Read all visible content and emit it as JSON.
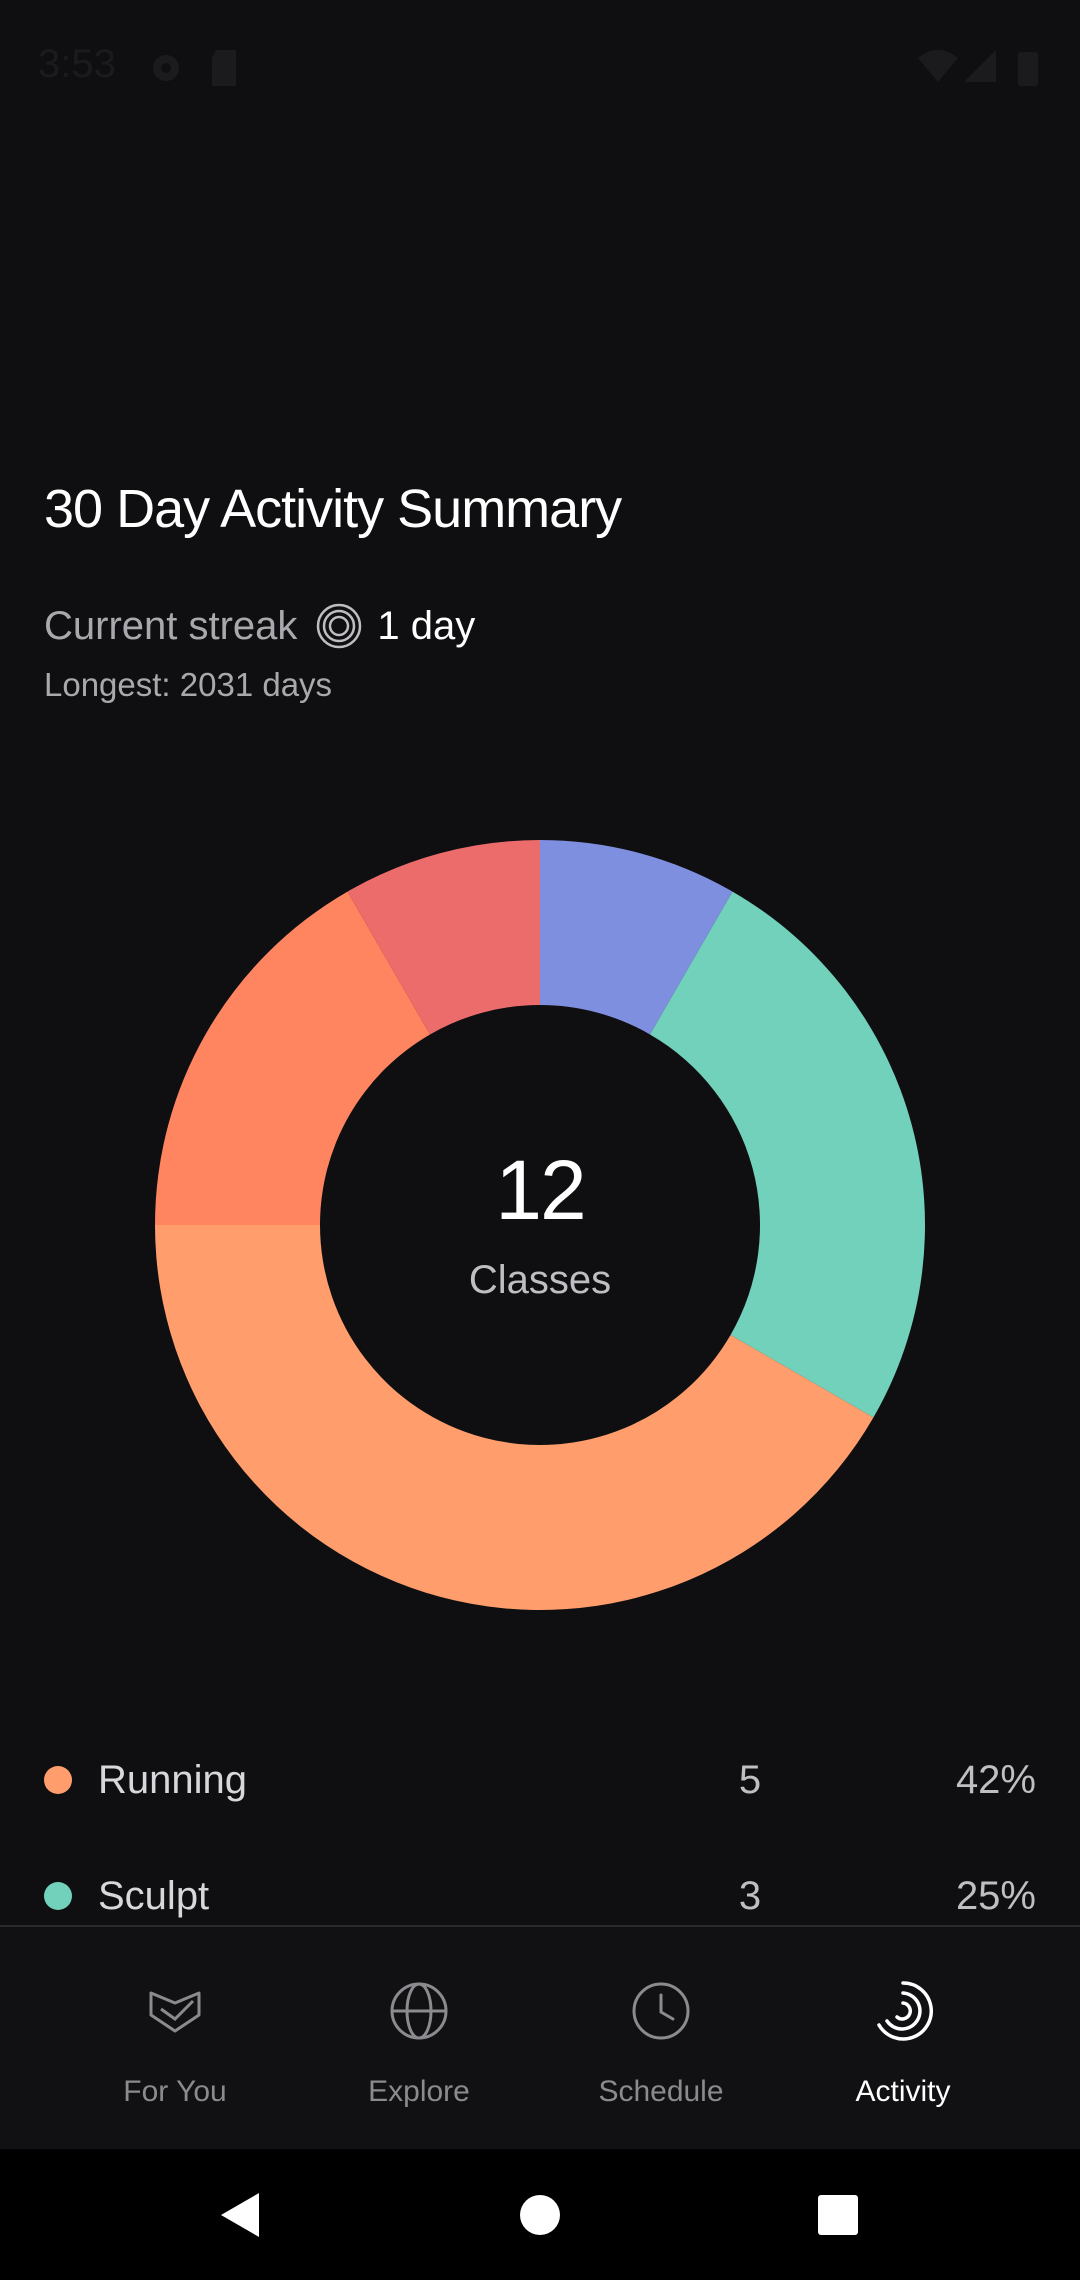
{
  "status_bar": {
    "time": "3:53"
  },
  "header": {
    "title": "30 Day Activity Summary",
    "streak_label": "Current streak",
    "streak_value": "1 day",
    "longest": "Longest: 2031 days"
  },
  "chart_data": {
    "type": "pie",
    "style": "donut",
    "center_value": "12",
    "center_label": "Classes",
    "categories": [
      "Running",
      "Sculpt",
      "Unlabeled (blue)",
      "Unlabeled (red)",
      "Unlabeled (coral)"
    ],
    "values": [
      5,
      3,
      1,
      1,
      2
    ],
    "colors": [
      "#ff9e6c",
      "#72d1bb",
      "#7f8fe0",
      "#ec6b6b",
      "#ff8561"
    ]
  },
  "legend": [
    {
      "name": "Running",
      "count": "5",
      "percent": "42%",
      "color": "#ff9e6c"
    },
    {
      "name": "Sculpt",
      "count": "3",
      "percent": "25%",
      "color": "#72d1bb"
    }
  ],
  "tabs": [
    {
      "label": "For You",
      "icon": "for-you-icon",
      "active": false
    },
    {
      "label": "Explore",
      "icon": "globe-icon",
      "active": false
    },
    {
      "label": "Schedule",
      "icon": "clock-icon",
      "active": false
    },
    {
      "label": "Activity",
      "icon": "activity-rings-icon",
      "active": true
    }
  ],
  "nav": {
    "back": "back-triangle-icon",
    "home": "home-circle-icon",
    "recents": "recents-square-icon"
  }
}
